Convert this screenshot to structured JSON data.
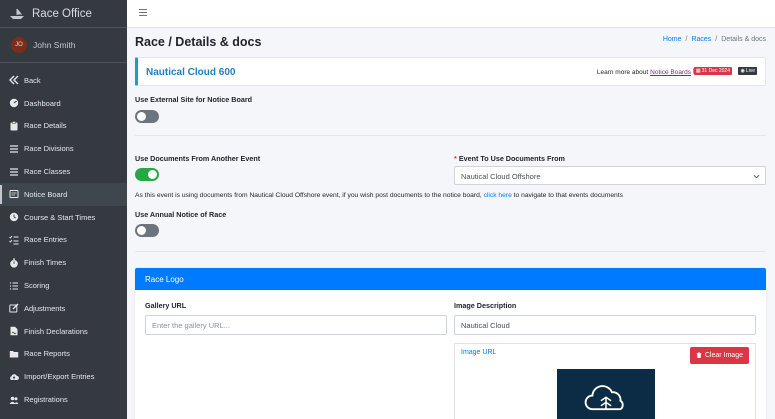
{
  "brand": {
    "name": "Race Office",
    "logo_icon": "boat-icon"
  },
  "user": {
    "initials": "JO",
    "name": "John Smith"
  },
  "sidebar": {
    "items": [
      {
        "label": "Back",
        "icon": "double-chevron-left-icon"
      },
      {
        "label": "Dashboard",
        "icon": "gauge-icon"
      },
      {
        "label": "Race Details",
        "icon": "clipboard-icon"
      },
      {
        "label": "Race Divisions",
        "icon": "list-icon"
      },
      {
        "label": "Race Classes",
        "icon": "list-icon"
      },
      {
        "label": "Notice Board",
        "icon": "notice-board-icon",
        "active": true
      },
      {
        "label": "Course & Start Times",
        "icon": "clock-icon"
      },
      {
        "label": "Race Entries",
        "icon": "checklist-icon"
      },
      {
        "label": "Finish Times",
        "icon": "stopwatch-icon"
      },
      {
        "label": "Scoring",
        "icon": "scoring-list-icon"
      },
      {
        "label": "Adjustments",
        "icon": "edit-icon"
      },
      {
        "label": "Finish Declarations",
        "icon": "file-signature-icon"
      },
      {
        "label": "Race Reports",
        "icon": "folder-icon"
      },
      {
        "label": "Import/Export Entries",
        "icon": "cloud-upload-icon"
      },
      {
        "label": "Registrations",
        "icon": "users-icon"
      }
    ]
  },
  "page": {
    "title": "Race / Details & docs",
    "breadcrumb": {
      "home": "Home",
      "sep1": "/",
      "races": "Races",
      "sep2": "/",
      "current": "Details & docs"
    }
  },
  "event": {
    "name": "Nautical Cloud 600",
    "learn_prefix": "Learn more about",
    "learn_link": "Notice Boards",
    "date_badge": "31 Dec 2024",
    "live_badge": "Live"
  },
  "form": {
    "external_site_label": "Use External Site for Notice Board",
    "external_site_on": false,
    "use_docs_label": "Use Documents From Another Event",
    "use_docs_on": true,
    "event_select_required": "*",
    "event_select_label": "Event To Use Documents From",
    "event_select_value": "Nautical Cloud Offshore",
    "info_prefix": "As this event is using documents from Nautical Cloud Offshore event, if you wish post documents to the notice board,",
    "info_link": "click here",
    "info_suffix": "to navigate to that events documents",
    "annual_label": "Use Annual Notice of Race",
    "annual_on": false
  },
  "race_logo": {
    "header": "Race Logo",
    "gallery_label": "Gallery URL",
    "gallery_placeholder": "Enter the gallery URL...",
    "gallery_value": "",
    "image_desc_label": "Image Description",
    "image_desc_value": "Nautical Cloud",
    "image_url_label": "Image URL",
    "clear_button": "Clear Image"
  },
  "colors": {
    "sidebar": "#343a40",
    "accent": "#007bff",
    "success": "#28a745",
    "danger": "#dc3545"
  }
}
